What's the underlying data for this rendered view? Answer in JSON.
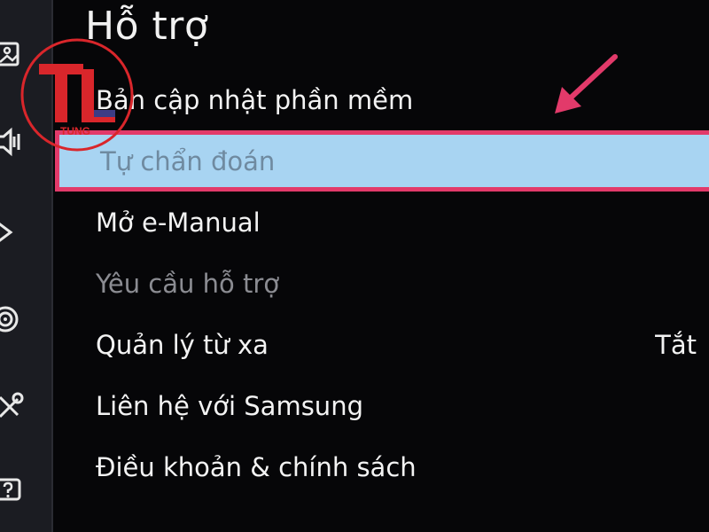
{
  "page_title": "Hỗ trợ",
  "menu": {
    "items": [
      {
        "label": "Bản cập nhật phần mềm",
        "state": "normal"
      },
      {
        "label": "Tự chẩn đoán",
        "state": "selected"
      },
      {
        "label": "Mở e-Manual",
        "state": "normal"
      },
      {
        "label": "Yêu cầu hỗ trợ",
        "state": "disabled"
      },
      {
        "label": "Quản lý từ xa",
        "state": "normal",
        "value": "Tắt"
      },
      {
        "label": "Liên hệ với Samsung",
        "state": "normal"
      },
      {
        "label": "Điều khoản & chính sách",
        "state": "normal"
      }
    ]
  },
  "sidebar": {
    "icons": [
      "picture-icon",
      "sound-icon",
      "broadcast-icon",
      "network-icon",
      "general-tools-icon",
      "support-icon"
    ]
  },
  "logo": {
    "text": "TUNG",
    "colors": {
      "ring": "#d9262b",
      "letters": "#d9262b",
      "accent": "#2a3f8f"
    }
  },
  "colors": {
    "selected_bg": "#a8d4f2",
    "selected_border": "#e23a6a",
    "arrow": "#e23a6a"
  }
}
